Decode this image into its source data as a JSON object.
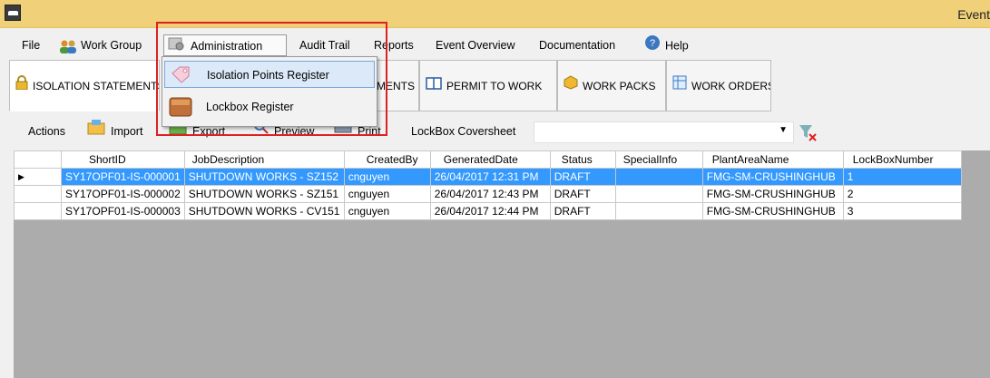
{
  "window": {
    "title": "Event"
  },
  "menu": {
    "file": "File",
    "workgroup": "Work Group",
    "administration": "Administration",
    "audit_trail": "Audit Trail",
    "reports": "Reports",
    "event_overview": "Event Overview",
    "documentation": "Documentation",
    "help": "Help"
  },
  "tabs": [
    {
      "label": "ISOLATION STATEMENTS"
    },
    {
      "label": "MENTS"
    },
    {
      "label": "PERMIT TO WORK"
    },
    {
      "label": "WORK PACKS"
    },
    {
      "label": "WORK ORDERS"
    }
  ],
  "toolbar": {
    "actions": "Actions",
    "import": "Import",
    "export": "Export",
    "preview": "Preview",
    "print": "Print",
    "coversheet": "LockBox Coversheet",
    "coversheet_value": ""
  },
  "admin_menu": {
    "items": [
      {
        "label": "Isolation Points Register"
      },
      {
        "label": "Lockbox Register"
      }
    ]
  },
  "grid": {
    "columns": [
      "ShortID",
      "JobDescription",
      "CreatedBy",
      "GeneratedDate",
      "Status",
      "SpecialInfo",
      "PlantAreaName",
      "LockBoxNumber"
    ],
    "rows": [
      [
        "SY17OPF01-IS-000001",
        "SHUTDOWN WORKS - SZ152",
        "cnguyen",
        "26/04/2017 12:31 PM",
        "DRAFT",
        "",
        "FMG-SM-CRUSHINGHUB",
        "1"
      ],
      [
        "SY17OPF01-IS-000002",
        "SHUTDOWN WORKS - SZ151",
        "cnguyen",
        "26/04/2017 12:43 PM",
        "DRAFT",
        "",
        "FMG-SM-CRUSHINGHUB",
        "2"
      ],
      [
        "SY17OPF01-IS-000003",
        "SHUTDOWN WORKS - CV151",
        "cnguyen",
        "26/04/2017 12:44 PM",
        "DRAFT",
        "",
        "FMG-SM-CRUSHINGHUB",
        "3"
      ]
    ],
    "selected_row": 0
  },
  "colors": {
    "titlebar": "#f0d078",
    "selection": "#3399ff",
    "highlight_box": "#e02020"
  }
}
